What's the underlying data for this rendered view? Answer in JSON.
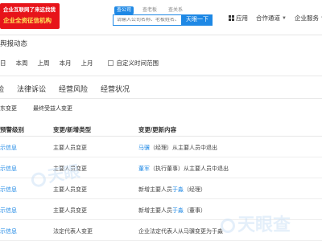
{
  "promo": {
    "line1": "企业互联网了来这找我",
    "line2": "企业全资征信机构"
  },
  "search": {
    "tabs": [
      "查公司",
      "查老板",
      "查关系"
    ],
    "placeholder": "请输入公司名称、老板姓名、品牌名称等",
    "button": "天眼一下"
  },
  "header_nav": {
    "apps": "应用",
    "cooperation": "合作通道",
    "enterprise": "企业服务"
  },
  "page_title": "舆报动态",
  "filters": {
    "items": [
      "日",
      "本周",
      "上周",
      "本月",
      "上月"
    ],
    "custom_range": "自定义时间范围"
  },
  "main_tabs": [
    "险",
    "法律诉讼",
    "经营风险",
    "经营状况"
  ],
  "sub_tabs": [
    "东变更",
    "最终受益人变更"
  ],
  "table": {
    "headers": [
      "预警级别",
      "变更/新增类型",
      "变更/更新内容"
    ],
    "rows": [
      {
        "level": "示信息",
        "type": "主要人员变更",
        "name": "马骥",
        "detail": "（经理）从主要人员中退出"
      },
      {
        "level": "示信息",
        "type": "主要人员变更",
        "name": "董军",
        "detail": "（执行董事）从主要人员中退出"
      },
      {
        "level": "示信息",
        "type": "主要人员变更",
        "name": "新增主要人员",
        "detail_link": "于淼",
        "detail": "（经理）"
      },
      {
        "level": "示信息",
        "type": "主要人员变更",
        "name": "新增主要人员",
        "detail_link": "于淼",
        "detail": "（董事）"
      },
      {
        "level": "示信息",
        "type": "法定代表人变更",
        "name": "企业法定代表人从马骥变更为于淼",
        "detail": ""
      }
    ]
  },
  "watermark": {
    "text1": "天眼",
    "text2": "天眼查"
  }
}
